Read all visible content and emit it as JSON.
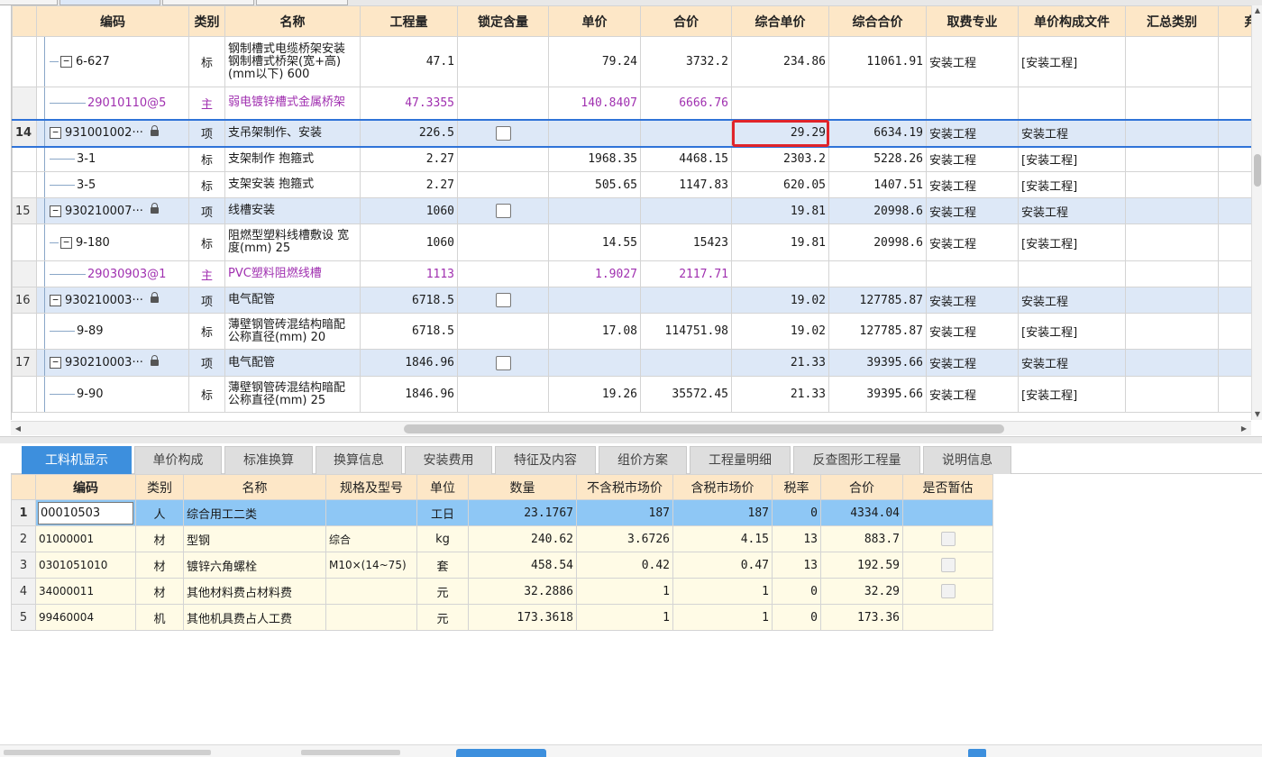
{
  "upper_table": {
    "headers": [
      "编码",
      "类别",
      "名称",
      "工程量",
      "锁定含量",
      "单价",
      "合价",
      "综合单价",
      "综合合价",
      "取费专业",
      "单价构成文件",
      "汇总类别",
      "弃"
    ],
    "rows": [
      {
        "row_no": "",
        "kind": "child",
        "code": "6-627",
        "type": "标",
        "name": "钢制槽式电缆桥架安装 钢制槽式桥架(宽+高)(mm以下) 600",
        "qty": "47.1",
        "lock": false,
        "price": "79.24",
        "total": "3732.2",
        "unit_price": "234.86",
        "unit_total": "11061.91",
        "discipline": "安装工程",
        "price_file": "[安装工程]"
      },
      {
        "row_no": "",
        "kind": "mat",
        "code": "29010110@5",
        "type": "主",
        "name": "弱电镀锌槽式金属桥架",
        "qty": "47.3355",
        "lock": false,
        "price": "140.8407",
        "total": "6666.76",
        "unit_price": "",
        "unit_total": "",
        "discipline": "",
        "price_file": ""
      },
      {
        "row_no": "14",
        "kind": "parent",
        "code": "931001002···",
        "type": "项",
        "name": "支吊架制作、安装",
        "qty": "226.5",
        "lock": true,
        "price": "",
        "total": "",
        "unit_price": "29.29",
        "unit_total": "6634.19",
        "discipline": "安装工程",
        "price_file": "安装工程"
      },
      {
        "row_no": "",
        "kind": "child",
        "code": "3-1",
        "type": "标",
        "name": "支架制作 抱箍式",
        "qty": "2.27",
        "lock": false,
        "price": "1968.35",
        "total": "4468.15",
        "unit_price": "2303.2",
        "unit_total": "5228.26",
        "discipline": "安装工程",
        "price_file": "[安装工程]"
      },
      {
        "row_no": "",
        "kind": "child",
        "code": "3-5",
        "type": "标",
        "name": "支架安装 抱箍式",
        "qty": "2.27",
        "lock": false,
        "price": "505.65",
        "total": "1147.83",
        "unit_price": "620.05",
        "unit_total": "1407.51",
        "discipline": "安装工程",
        "price_file": "[安装工程]"
      },
      {
        "row_no": "15",
        "kind": "parent",
        "code": "930210007···",
        "type": "项",
        "name": "线槽安装",
        "qty": "1060",
        "lock": true,
        "price": "",
        "total": "",
        "unit_price": "19.81",
        "unit_total": "20998.6",
        "discipline": "安装工程",
        "price_file": "安装工程"
      },
      {
        "row_no": "",
        "kind": "child",
        "code": "9-180",
        "type": "标",
        "name": "阻燃型塑料线槽敷设 宽度(mm) 25",
        "qty": "1060",
        "lock": false,
        "price": "14.55",
        "total": "15423",
        "unit_price": "19.81",
        "unit_total": "20998.6",
        "discipline": "安装工程",
        "price_file": "[安装工程]"
      },
      {
        "row_no": "",
        "kind": "mat",
        "code": "29030903@1",
        "type": "主",
        "name": "PVC塑料阻燃线槽",
        "qty": "1113",
        "lock": false,
        "price": "1.9027",
        "total": "2117.71",
        "unit_price": "",
        "unit_total": "",
        "discipline": "",
        "price_file": ""
      },
      {
        "row_no": "16",
        "kind": "parent",
        "code": "930210003···",
        "type": "项",
        "name": "电气配管",
        "qty": "6718.5",
        "lock": true,
        "price": "",
        "total": "",
        "unit_price": "19.02",
        "unit_total": "127785.87",
        "discipline": "安装工程",
        "price_file": "安装工程"
      },
      {
        "row_no": "",
        "kind": "child",
        "code": "9-89",
        "type": "标",
        "name": "薄壁钢管砖混结构暗配 公称直径(mm) 20",
        "qty": "6718.5",
        "lock": false,
        "price": "17.08",
        "total": "114751.98",
        "unit_price": "19.02",
        "unit_total": "127785.87",
        "discipline": "安装工程",
        "price_file": "[安装工程]"
      },
      {
        "row_no": "17",
        "kind": "parent",
        "code": "930210003···",
        "type": "项",
        "name": "电气配管",
        "qty": "1846.96",
        "lock": true,
        "price": "",
        "total": "",
        "unit_price": "21.33",
        "unit_total": "39395.66",
        "discipline": "安装工程",
        "price_file": "安装工程"
      },
      {
        "row_no": "",
        "kind": "child",
        "code": "9-90",
        "type": "标",
        "name": "薄壁钢管砖混结构暗配 公称直径(mm) 25",
        "qty": "1846.96",
        "lock": false,
        "price": "19.26",
        "total": "35572.45",
        "unit_price": "21.33",
        "unit_total": "39395.66",
        "discipline": "安装工程",
        "price_file": "[安装工程]"
      }
    ]
  },
  "bottom_tabs": [
    "工料机显示",
    "单价构成",
    "标准换算",
    "换算信息",
    "安装费用",
    "特征及内容",
    "组价方案",
    "工程量明细",
    "反查图形工程量",
    "说明信息"
  ],
  "lower_table": {
    "headers": [
      "编码",
      "类别",
      "名称",
      "规格及型号",
      "单位",
      "数量",
      "不含税市场价",
      "含税市场价",
      "税率",
      "合价",
      "是否暂估"
    ],
    "rows": [
      {
        "no": "1",
        "code": "00010503",
        "type": "人",
        "name": "综合用工二类",
        "spec": "",
        "unit": "工日",
        "qty": "23.1767",
        "price_ex": "187",
        "price_in": "187",
        "tax": "0",
        "total": "4334.04",
        "est": "none"
      },
      {
        "no": "2",
        "code": "01000001",
        "type": "材",
        "name": "型钢",
        "spec": "综合",
        "unit": "kg",
        "qty": "240.62",
        "price_ex": "3.6726",
        "price_in": "4.15",
        "tax": "13",
        "total": "883.7",
        "est": "box"
      },
      {
        "no": "3",
        "code": "0301051010",
        "type": "材",
        "name": "镀锌六角螺栓",
        "spec": "M10×(14~75)",
        "unit": "套",
        "qty": "458.54",
        "price_ex": "0.42",
        "price_in": "0.47",
        "tax": "13",
        "total": "192.59",
        "est": "box"
      },
      {
        "no": "4",
        "code": "34000011",
        "type": "材",
        "name": "其他材料费占材料费",
        "spec": "",
        "unit": "元",
        "qty": "32.2886",
        "price_ex": "1",
        "price_in": "1",
        "tax": "0",
        "total": "32.29",
        "est": "box"
      },
      {
        "no": "5",
        "code": "99460004",
        "type": "机",
        "name": "其他机具费占人工费",
        "spec": "",
        "unit": "元",
        "qty": "173.3618",
        "price_ex": "1",
        "price_in": "1",
        "tax": "0",
        "total": "173.36",
        "est": "none"
      }
    ]
  },
  "colors": {
    "accent": "#3d8fdd",
    "header_bg": "#fde7c7",
    "parent_row_bg": "#dde8f7",
    "material_text": "#a030b0",
    "highlight_outline": "#e0242a",
    "selected_row_bg": "#8ec7f5"
  }
}
